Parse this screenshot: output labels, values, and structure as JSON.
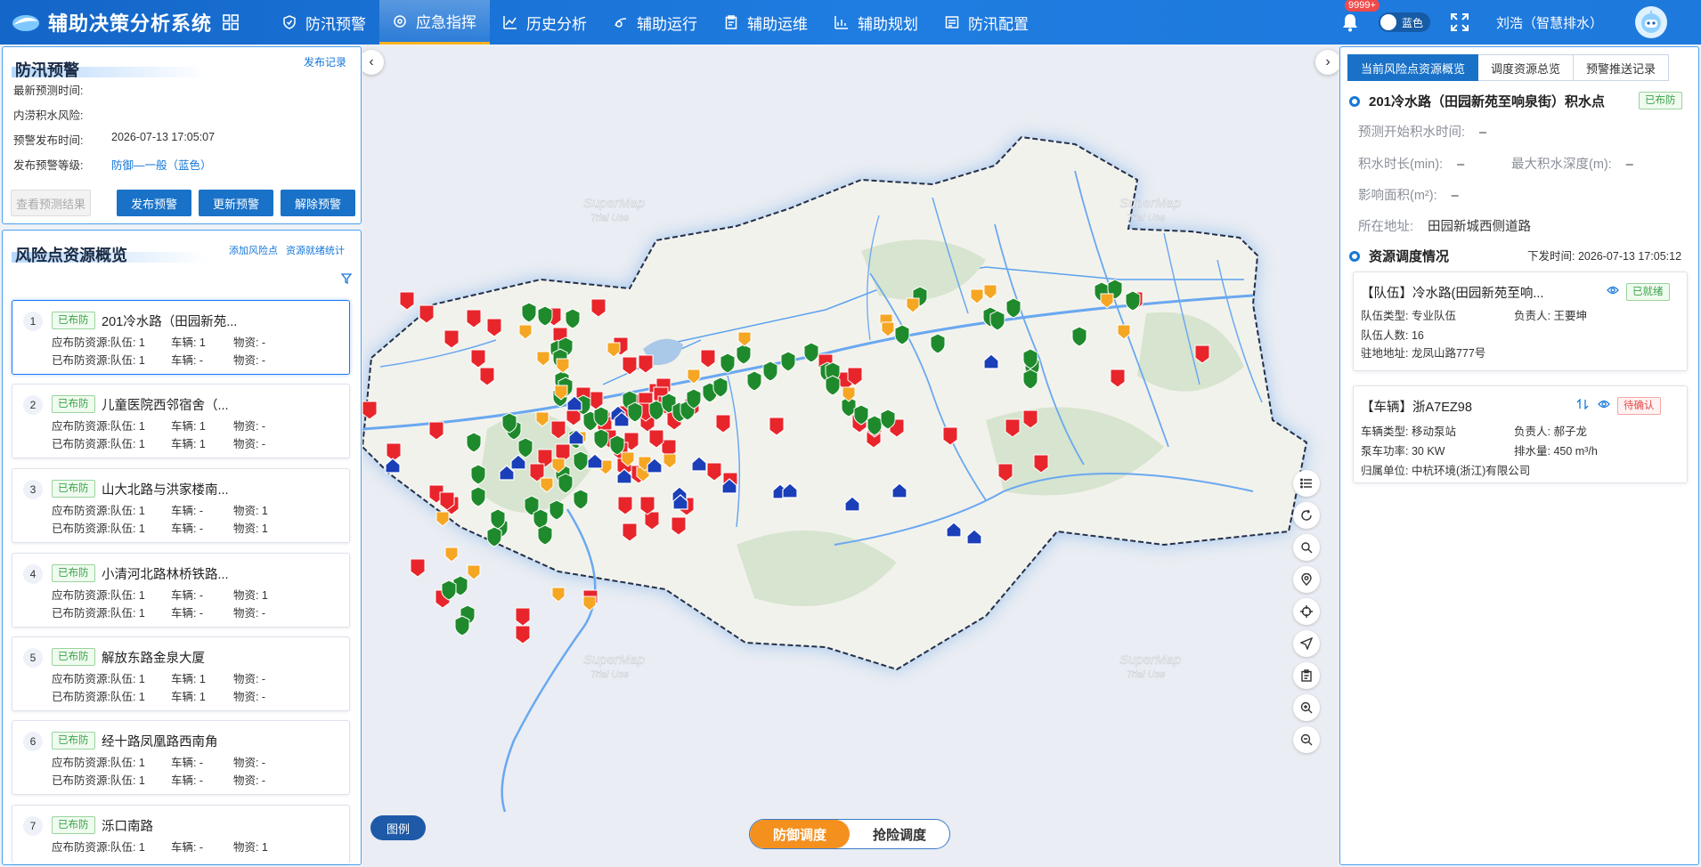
{
  "app": {
    "title": "辅助决策分析系统"
  },
  "nav": [
    {
      "label": "防汛预警",
      "icon": "shield-icon"
    },
    {
      "label": "应急指挥",
      "icon": "command-icon",
      "active": true
    },
    {
      "label": "历史分析",
      "icon": "chart-icon"
    },
    {
      "label": "辅助运行",
      "icon": "run-icon"
    },
    {
      "label": "辅助运维",
      "icon": "clipboard-icon"
    },
    {
      "label": "辅助规划",
      "icon": "plan-icon"
    },
    {
      "label": "防汛配置",
      "icon": "config-icon"
    }
  ],
  "header": {
    "notify_count": "9999+",
    "theme_label": "蓝色",
    "user": "刘浩（智慧排水）"
  },
  "warning": {
    "title": "防汛预警",
    "record_link": "发布记录",
    "rows": [
      {
        "label": "最新预测时间:",
        "value": ""
      },
      {
        "label": "内涝积水风险:",
        "value": ""
      },
      {
        "label": "预警发布时间:",
        "value": "2026-07-13 17:05:07"
      },
      {
        "label": "发布预警等级:",
        "value": "防御—一般（蓝色）"
      }
    ],
    "buttons": {
      "view": "查看预测结果",
      "publish": "发布预警",
      "update": "更新预警",
      "release": "解除预警"
    }
  },
  "risk": {
    "title": "风险点资源概览",
    "add_link": "添加风险点",
    "stat_link": "资源就绪统计",
    "items": [
      {
        "no": "1",
        "tag": "已布防",
        "name": "201冷水路（田园新苑...",
        "need": {
          "label": "应布防资源:",
          "team": "队伍:  1",
          "car": "车辆:  1",
          "mat": "物资:  -"
        },
        "done": {
          "label": "已布防资源:",
          "team": "队伍:  1",
          "car": "车辆:  -",
          "mat": "物资:  -"
        }
      },
      {
        "no": "2",
        "tag": "已布防",
        "name": "儿童医院西邻宿舍（...",
        "need": {
          "label": "应布防资源:",
          "team": "队伍:  1",
          "car": "车辆:  1",
          "mat": "物资:  -"
        },
        "done": {
          "label": "已布防资源:",
          "team": "队伍:  1",
          "car": "车辆:  1",
          "mat": "物资:  -"
        }
      },
      {
        "no": "3",
        "tag": "已布防",
        "name": "山大北路与洪家楼南...",
        "need": {
          "label": "应布防资源:",
          "team": "队伍:  1",
          "car": "车辆:  -",
          "mat": "物资:  1"
        },
        "done": {
          "label": "已布防资源:",
          "team": "队伍:  1",
          "car": "车辆:  -",
          "mat": "物资:  1"
        }
      },
      {
        "no": "4",
        "tag": "已布防",
        "name": "小清河北路林桥铁路...",
        "need": {
          "label": "应布防资源:",
          "team": "队伍:  1",
          "car": "车辆:  -",
          "mat": "物资:  1"
        },
        "done": {
          "label": "已布防资源:",
          "team": "队伍:  1",
          "car": "车辆:  -",
          "mat": "物资:  -"
        }
      },
      {
        "no": "5",
        "tag": "已布防",
        "name": "解放东路金泉大厦",
        "need": {
          "label": "应布防资源:",
          "team": "队伍:  1",
          "car": "车辆:  1",
          "mat": "物资:  -"
        },
        "done": {
          "label": "已布防资源:",
          "team": "队伍:  1",
          "car": "车辆:  1",
          "mat": "物资:  -"
        }
      },
      {
        "no": "6",
        "tag": "已布防",
        "name": "经十路凤凰路西南角",
        "need": {
          "label": "应布防资源:",
          "team": "队伍:  1",
          "car": "车辆:  -",
          "mat": "物资:  -"
        },
        "done": {
          "label": "已布防资源:",
          "team": "队伍:  1",
          "car": "车辆:  -",
          "mat": "物资:  -"
        }
      },
      {
        "no": "7",
        "tag": "已布防",
        "name": "泺口南路",
        "need": {
          "label": "应布防资源:",
          "team": "队伍:  1",
          "car": "车辆:  -",
          "mat": "物资:  1"
        }
      }
    ]
  },
  "map": {
    "watermark_line1": "SuperMap",
    "watermark_line2": "Trial Use",
    "legend": "图例",
    "modes": [
      "防御调度",
      "抢险调度"
    ]
  },
  "right": {
    "tabs": [
      "当前风险点资源概览",
      "调度资源总览",
      "预警推送记录"
    ],
    "point_title": "201冷水路（田园新苑至响泉街）积水点",
    "point_tag": "已布防",
    "fields": {
      "start_label": "预测开始积水时间:",
      "start": "–",
      "duration_label": "积水时长(min):",
      "duration": "–",
      "depth_label": "最大积水深度(m):",
      "depth": "–",
      "area_label": "影响面积(m²):",
      "area": "–",
      "addr_label": "所在地址:",
      "addr": "田园新城西侧道路"
    },
    "dispatch_title": "资源调度情况",
    "dispatch_time": "下发时间:  2026-07-13 17:05:12",
    "team": {
      "title": "【队伍】冷水路(田园新苑至响...",
      "tag": "已就绪",
      "type": "队伍类型:  专业队伍",
      "lead": "负责人:  王要坤",
      "count": "队伍人数:  16",
      "addr": "驻地地址:  龙凤山路777号"
    },
    "car": {
      "title": "【车辆】浙A7EZ98",
      "tag": "待确认",
      "type": "车辆类型:  移动泵站",
      "lead": "负责人:  郝子龙",
      "power": "泵车功率:  30 KW",
      "flow": "排水量:  450 m³/h",
      "unit": "归属单位:  中杭环境(浙江)有限公司"
    }
  }
}
